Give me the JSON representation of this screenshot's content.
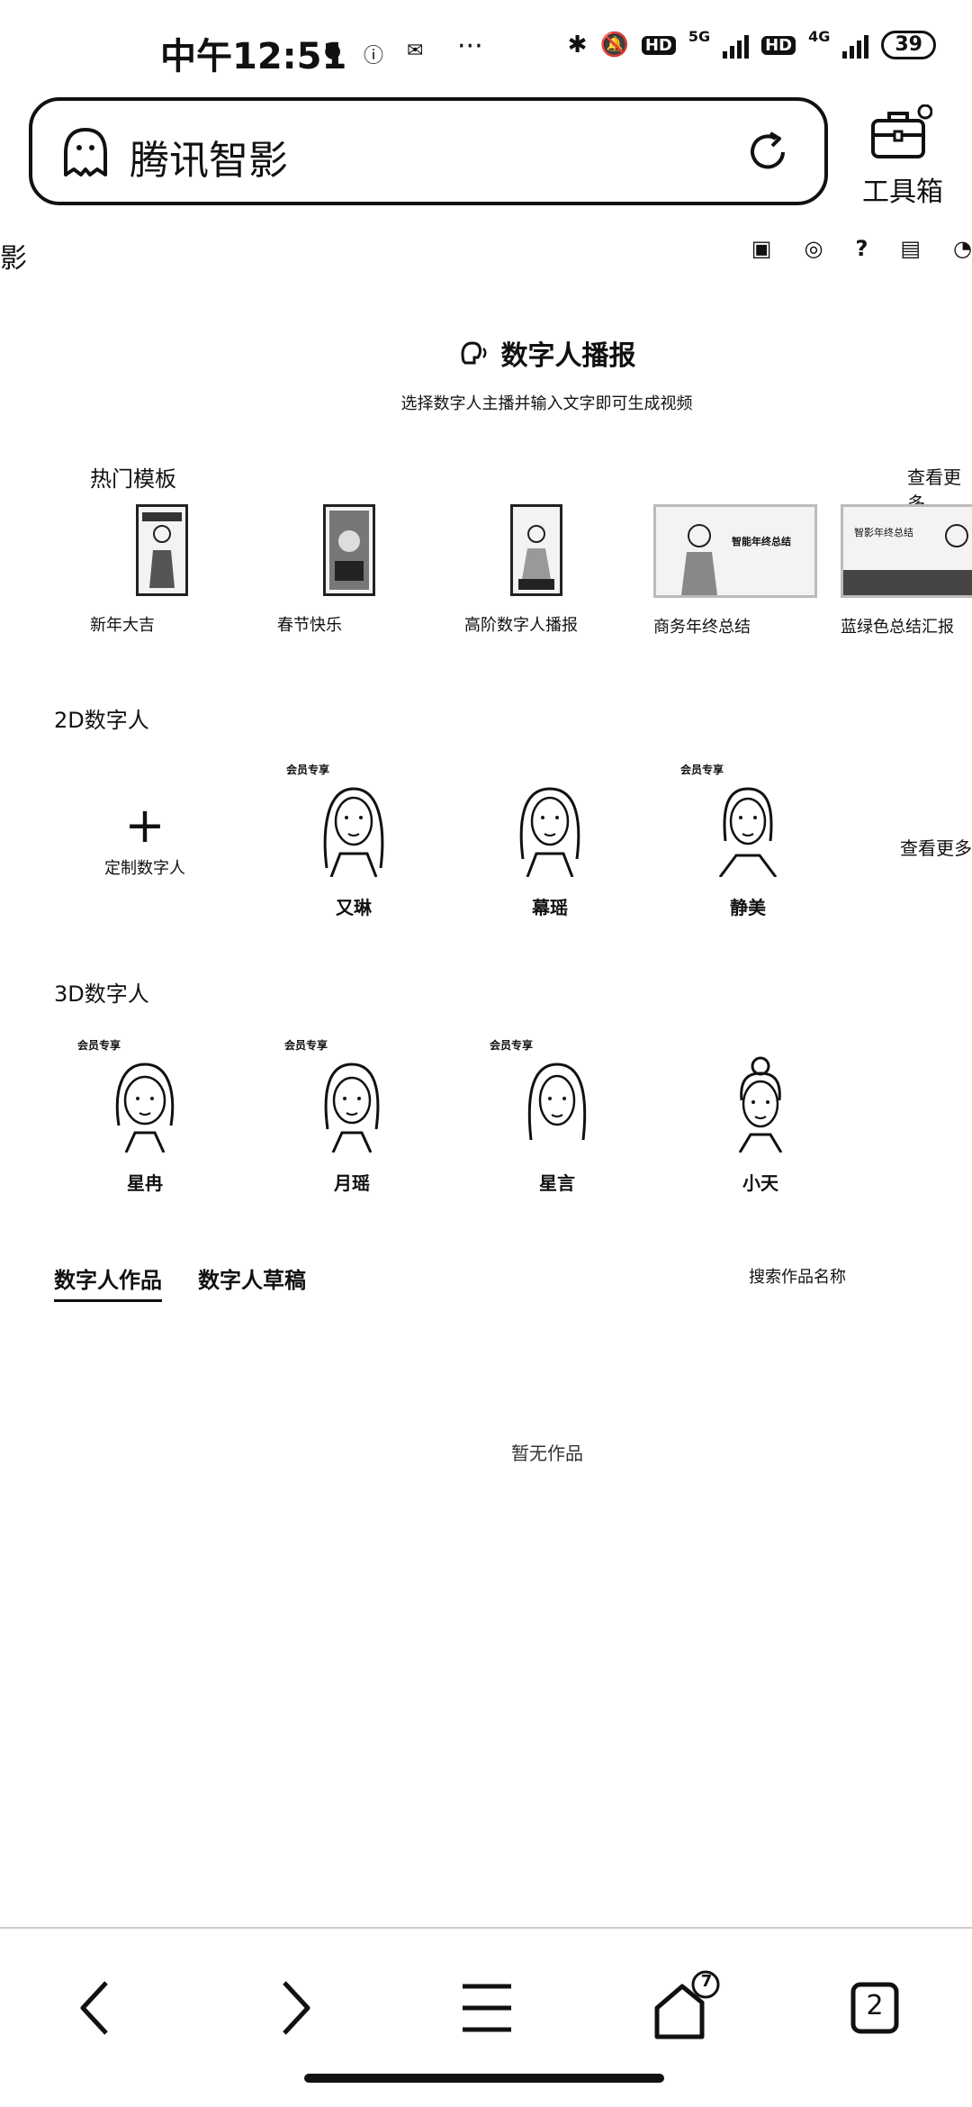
{
  "status_bar": {
    "time": "中午12:51",
    "dots": "···",
    "net_5g": "5G",
    "net_4g": "4G",
    "hd": "HD",
    "battery": "39"
  },
  "browser": {
    "title": "腾讯智影",
    "toolbox_label": "工具箱"
  },
  "site_header": {
    "logo_fragment": "影"
  },
  "feature": {
    "title": "数字人播报",
    "subtitle": "选择数字人主播并输入文字即可生成视频"
  },
  "templates": {
    "title": "热门模板",
    "more": "查看更多",
    "items": [
      {
        "label": "新年大吉"
      },
      {
        "label": "春节快乐"
      },
      {
        "label": "高阶数字人播报"
      },
      {
        "label": "商务年终总结",
        "thumb_text": "智能年终总结"
      },
      {
        "label": "蓝绿色总结汇报",
        "thumb_text": "智影年终总结"
      }
    ]
  },
  "avatars_2d": {
    "title": "2D数字人",
    "custom_label": "定制数字人",
    "more": "查看更多",
    "items": [
      {
        "name": "又琳",
        "badge": "会员专享"
      },
      {
        "name": "幕瑶",
        "badge": ""
      },
      {
        "name": "静美",
        "badge": "会员专享"
      }
    ]
  },
  "avatars_3d": {
    "title": "3D数字人",
    "items": [
      {
        "name": "星冉",
        "badge": "会员专享"
      },
      {
        "name": "月瑶",
        "badge": "会员专享"
      },
      {
        "name": "星言",
        "badge": "会员专享"
      },
      {
        "name": "小天",
        "badge": ""
      }
    ]
  },
  "works": {
    "tab_works": "数字人作品",
    "tab_drafts": "数字人草稿",
    "search_placeholder": "搜索作品名称",
    "empty": "暂无作品"
  },
  "bottom_nav": {
    "home_badge": "7",
    "tabs_count": "2"
  }
}
